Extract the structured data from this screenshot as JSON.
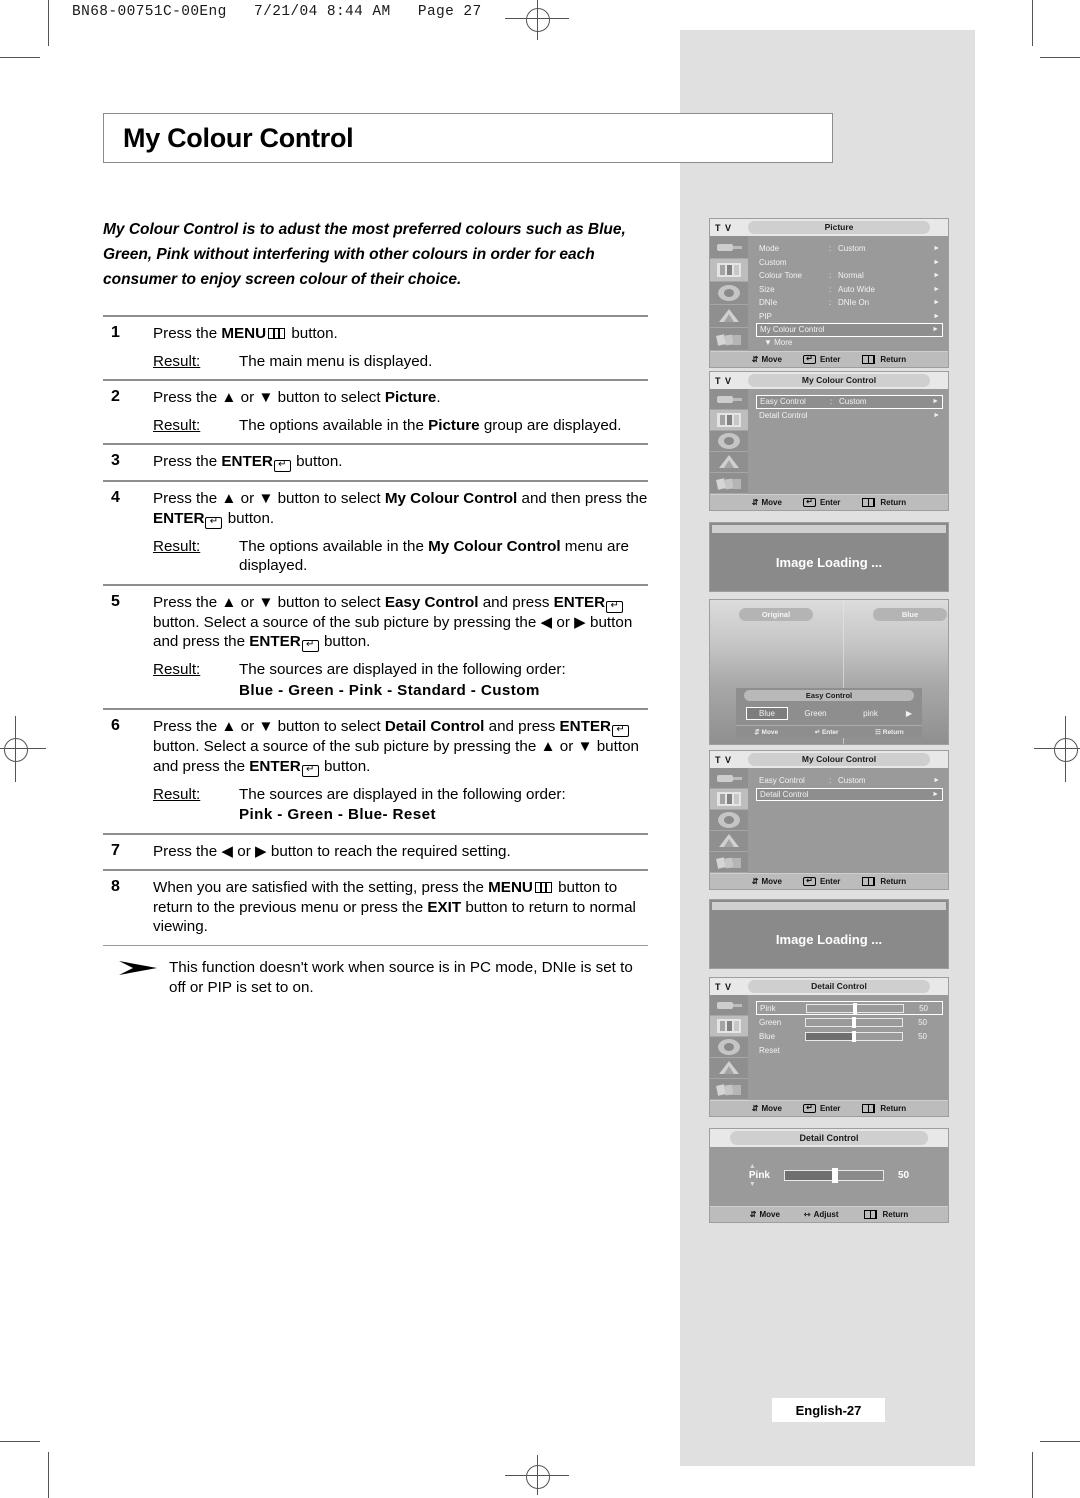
{
  "print_header": "BN68-00751C-00Eng   7/21/04 8:44 AM   Page 27",
  "title": "My Colour Control",
  "intro": "My Colour Control is to adust the most preferred colours such as Blue, Green, Pink without interfering with other colours in order for each consumer to enjoy screen colour of their choice.",
  "labels": {
    "result": "Result:",
    "press_the": "Press the",
    "or": "or",
    "button": "button."
  },
  "steps": [
    {
      "num": "1",
      "line_a": "Press the ",
      "bold_a": "MENU",
      "icon_a": "menu-icon",
      "line_b": " button.",
      "result": "The main menu is displayed."
    },
    {
      "num": "2",
      "text": "Press the ▲ or ▼ button to select Picture.",
      "result": "The options available in the Picture group are displayed."
    },
    {
      "num": "3",
      "text": "Press the ENTER button."
    },
    {
      "num": "4",
      "text": "Press the ▲ or ▼ button to select My Colour Control and then press the ENTER button.",
      "result": "The options available in the My Colour Control menu are displayed."
    },
    {
      "num": "5",
      "text": "Press the ▲ or ▼ button to select Easy Control and press ENTER button. Select a source of the sub picture by pressing the ◀ or ▶ button and press the ENTER button.",
      "result": "The sources are displayed in the following order:",
      "order": "Blue - Green  -  Pink - Standard - Custom"
    },
    {
      "num": "6",
      "text": "Press the ▲ or ▼ button to select Detail Control and press ENTER button.  Select a source of the sub picture by pressing the ▲ or ▼ button and press the ENTER button.",
      "result": "The sources are displayed in the following order:",
      "order": "Pink - Green - Blue- Reset"
    },
    {
      "num": "7",
      "text": "Press the ◀ or ▶ button to reach the required setting."
    },
    {
      "num": "8",
      "text": "When you are satisfied with the setting, press the MENU button to return to the previous menu or press the EXIT button to return to normal viewing."
    }
  ],
  "note": "This function doesn't work when source is in PC mode, DNIe is set to off or PIP is set to on.",
  "step_fragments": {
    "s1_pre": "Press the ",
    "s1_menu": "MENU",
    "s1_post": " button.",
    "s1_result": "The main menu is displayed.",
    "s2_pre": "Press the ▲ or ▼ button to select ",
    "s2_bold": "Picture",
    "s2_post": ".",
    "s2_result_a": "The options available in the ",
    "s2_result_b": "Picture",
    "s2_result_c": " group are displayed.",
    "s3_pre": "Press the ",
    "s3_bold": "ENTER",
    "s3_post": " button.",
    "s4_pre": "Press the ▲ or ▼ button to select ",
    "s4_bold": "My Colour Control",
    "s4_mid": " and then press the ",
    "s4_bold2": "ENTER",
    "s4_post": " button.",
    "s4_result_a": "The options available in the ",
    "s4_result_b": "My Colour Control",
    "s4_result_c": " menu are displayed.",
    "s5_pre": "Press the ▲ or ▼ button to select ",
    "s5_bold": "Easy Control",
    "s5_mid": " and press ",
    "s5_bold2": "ENTER",
    "s5_mid2": " button. Select a source of the sub picture by pressing the ◀ or ▶ button and press the ",
    "s5_bold3": "ENTER",
    "s5_post": " button.",
    "s5_result": "The sources are displayed in the following order:",
    "s5_order": "Blue - Green  -  Pink - Standard - Custom",
    "s6_pre": "Press the ▲ or ▼ button to select ",
    "s6_bold": "Detail Control",
    "s6_mid": " and press ",
    "s6_bold2": "ENTER",
    "s6_mid2": " button.  Select a source of the sub picture by pressing the ▲ or ▼ button and press the ",
    "s6_bold3": "ENTER",
    "s6_post": " button.",
    "s6_result": "The sources are displayed in the following order:",
    "s6_order": "Pink - Green - Blue- Reset",
    "s7_text": "Press the ◀ or ▶ button to reach the required setting.",
    "s8_pre": "When you are satisfied with the setting, press the ",
    "s8_bold": "MENU",
    "s8_mid": " button to return to the previous menu or press the ",
    "s8_bold2": "EXIT",
    "s8_post": " button to return to normal viewing."
  },
  "osd": {
    "tv_label": "T V",
    "footer": {
      "move": "Move",
      "enter": "Enter",
      "return": "Return",
      "adjust": "Adjust"
    },
    "picture_menu": {
      "title": "Picture",
      "rows": [
        {
          "label": "Mode",
          "colon": ":",
          "value": "Custom",
          "highlight": false
        },
        {
          "label": "Custom",
          "colon": "",
          "value": "",
          "highlight": false
        },
        {
          "label": "Colour Tone",
          "colon": ":",
          "value": "Normal",
          "highlight": false
        },
        {
          "label": "Size",
          "colon": ":",
          "value": "Auto Wide",
          "highlight": false
        },
        {
          "label": "DNIe",
          "colon": ":",
          "value": "DNIe On",
          "highlight": false
        },
        {
          "label": "PIP",
          "colon": "",
          "value": "",
          "highlight": false
        },
        {
          "label": "My Colour Control",
          "colon": "",
          "value": "",
          "highlight": true
        }
      ],
      "more": "▼  More"
    },
    "mcc_menu_easy": {
      "title": "My Colour Control",
      "rows": [
        {
          "label": "Easy Control",
          "colon": ":",
          "value": "Custom",
          "highlight": true
        },
        {
          "label": "Detail Control",
          "colon": "",
          "value": "",
          "highlight": false
        }
      ]
    },
    "mcc_menu_detail": {
      "title": "My Colour Control",
      "rows": [
        {
          "label": "Easy Control",
          "colon": ":",
          "value": "Custom",
          "highlight": false
        },
        {
          "label": "Detail Control",
          "colon": "",
          "value": "",
          "highlight": true
        }
      ]
    },
    "detail_menu": {
      "title": "Detail Control",
      "rows": [
        {
          "label": "Pink",
          "value": "50",
          "highlight": true
        },
        {
          "label": "Green",
          "value": "50",
          "highlight": false
        },
        {
          "label": "Blue",
          "value": "50",
          "highlight": false
        }
      ],
      "reset": "Reset"
    },
    "detail_compact": {
      "title": "Detail Control",
      "label": "Pink",
      "value": "50"
    },
    "easy_photo": {
      "tag_left": "Original",
      "tag_right": "Blue",
      "bar_title": "Easy Control",
      "options": [
        {
          "label": "Blue",
          "highlight": true
        },
        {
          "label": "Green",
          "highlight": false
        },
        {
          "label": "pink",
          "highlight": false
        }
      ],
      "arrow": "▶"
    },
    "loading_text": "Image Loading ..."
  },
  "page_footer": "English-27"
}
